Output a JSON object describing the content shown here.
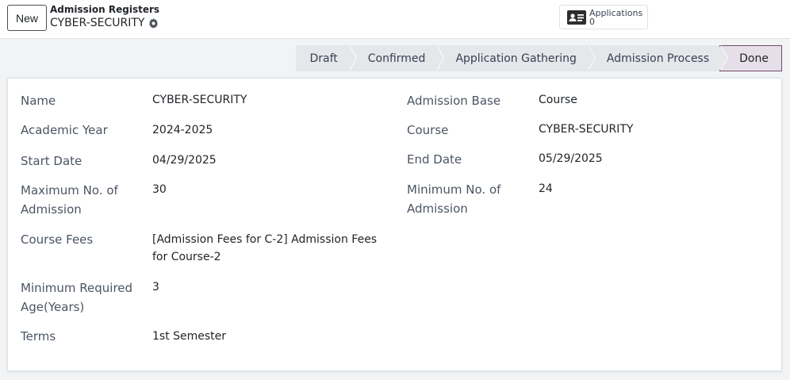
{
  "control_panel": {
    "new_button": "New",
    "breadcrumb_parent": "Admission Registers",
    "record_name": "CYBER-SECURITY"
  },
  "smart_button": {
    "label": "Applications",
    "count": "0"
  },
  "statusbar": {
    "stages": [
      "Draft",
      "Confirmed",
      "Application Gathering",
      "Admission Process",
      "Done"
    ],
    "active": "Done"
  },
  "fields": {
    "name": {
      "label": "Name",
      "value": "CYBER-SECURITY"
    },
    "academic_year": {
      "label": "Academic Year",
      "value": "2024-2025"
    },
    "start_date": {
      "label": "Start Date",
      "value": "04/29/2025"
    },
    "max_admission": {
      "label_1": "Maximum No. of",
      "label_2": "Admission",
      "value": "30"
    },
    "course_fees": {
      "label": "Course Fees",
      "value_1": "[Admission Fees for C-2] Admission Fees",
      "value_2": "for Course-2"
    },
    "min_age": {
      "label_1": "Minimum Required",
      "label_2": "Age(Years)",
      "value": "3"
    },
    "terms": {
      "label": "Terms",
      "value": "1st Semester"
    },
    "admission_base": {
      "label": "Admission Base",
      "value": "Course"
    },
    "course": {
      "label": "Course",
      "value": "CYBER-SECURITY"
    },
    "end_date": {
      "label": "End Date",
      "value": "05/29/2025"
    },
    "min_admission": {
      "label_1": "Minimum No. of",
      "label_2": "Admission",
      "value": "24"
    }
  },
  "colors": {
    "accent": "#714b67",
    "active_stage_bg": "#e6dfea",
    "stage_bg": "#e5e7eb"
  }
}
